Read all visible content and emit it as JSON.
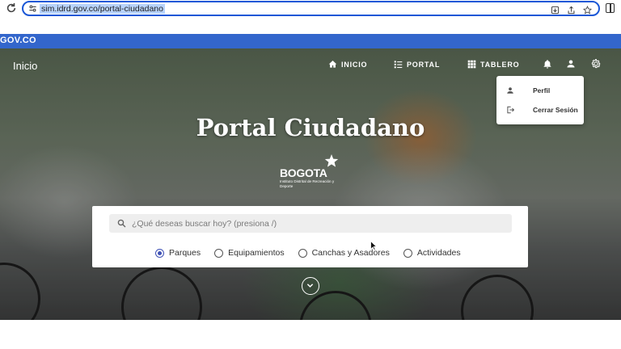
{
  "browser": {
    "url": "sim.idrd.gov.co/portal-ciudadano"
  },
  "gov": {
    "logo": "GOV.CO"
  },
  "nav": {
    "brand": "Inicio",
    "items": [
      {
        "label": "INICIO",
        "icon": "home-icon"
      },
      {
        "label": "PORTAL",
        "icon": "list-icon"
      },
      {
        "label": "TABLERO",
        "icon": "grid-icon"
      }
    ],
    "icons": [
      "bell-icon",
      "user-icon",
      "gear-icon"
    ]
  },
  "user_menu": {
    "items": [
      {
        "label": "Perfil",
        "icon": "person-icon"
      },
      {
        "label": "Cerrar Sesión",
        "icon": "logout-icon"
      }
    ]
  },
  "hero": {
    "title": "Portal Ciudadano",
    "logo_word": "BOGOTA",
    "logo_sub": "Instituto Distrital de Recreación y Deporte"
  },
  "search": {
    "placeholder": "¿Qué deseas buscar hoy? (presiona /)",
    "value": "",
    "options": [
      {
        "label": "Parques",
        "selected": true
      },
      {
        "label": "Equipamientos",
        "selected": false
      },
      {
        "label": "Canchas y Asadores",
        "selected": false
      },
      {
        "label": "Actividades",
        "selected": false
      }
    ]
  },
  "colors": {
    "gov_blue": "#3366cc",
    "radio_accent": "#3f51b5",
    "url_border": "#1a57d6"
  }
}
